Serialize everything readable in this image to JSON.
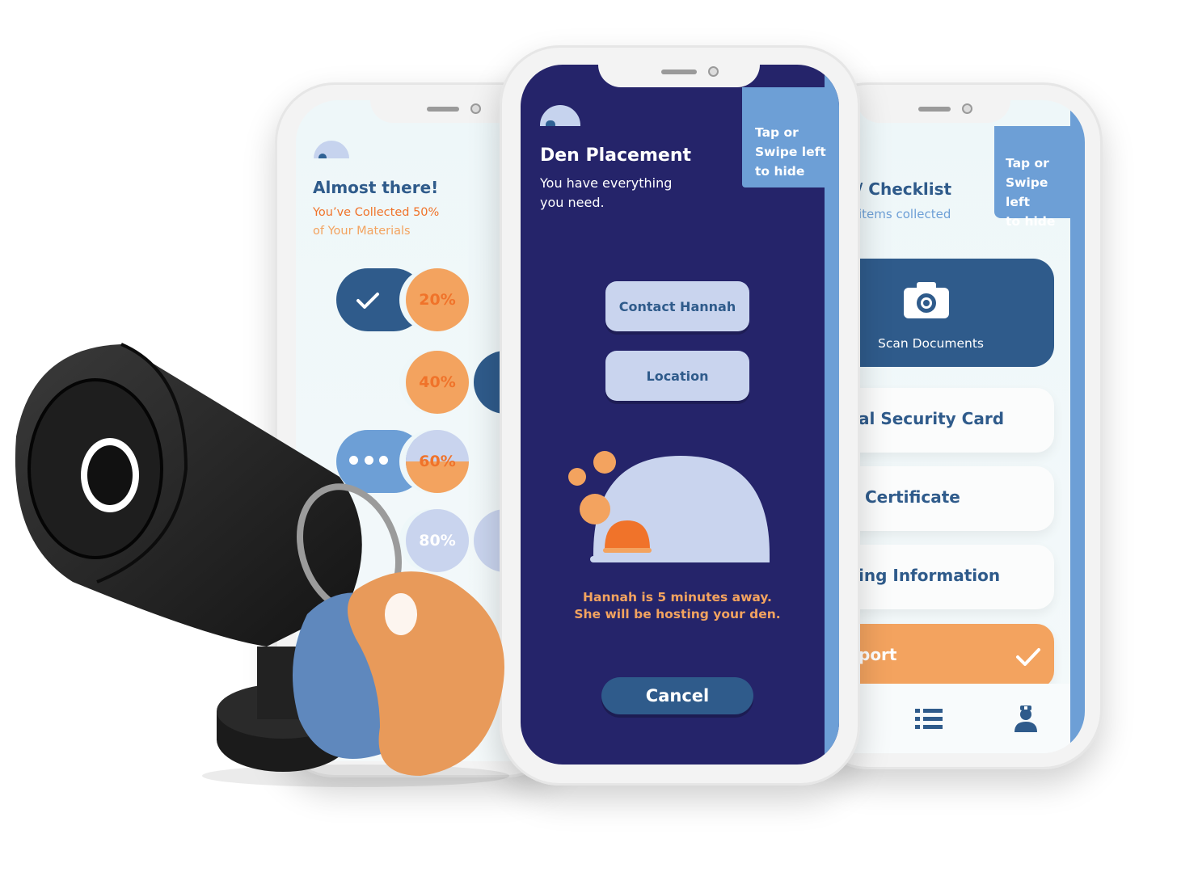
{
  "left_screen": {
    "title": "Almost there!",
    "subtitle_line1": "You’ve Collected 50%",
    "subtitle_line2": "of Your Materials",
    "steps": [
      {
        "label": "20%",
        "state": "complete"
      },
      {
        "label": "40%",
        "state": "complete"
      },
      {
        "label": "60%",
        "state": "in-progress"
      },
      {
        "label": "80%",
        "state": "pending"
      }
    ]
  },
  "center_screen": {
    "title": "Den Placement",
    "subtitle_line1": "You have everything",
    "subtitle_line2": "you need.",
    "hint_line1": "Tap or",
    "hint_line2": "Swipe left",
    "hint_line3": "to hide",
    "contact_button": "Contact Hannah",
    "location_button": "Location",
    "status_line1": "Hannah is 5 minutes away.",
    "status_line2": "She will be hosting your den.",
    "cancel_button": "Cancel"
  },
  "right_screen": {
    "title": "Checklist",
    "subtitle": "items collected",
    "hint_line1": "Tap or",
    "hint_line2": "Swipe left",
    "hint_line3": "to hide",
    "scan_label": "Scan Documents",
    "items": [
      {
        "label": "al Security Card"
      },
      {
        "label": "Certificate"
      },
      {
        "label": "ing Information"
      },
      {
        "label": "port"
      }
    ],
    "nav": [
      "list-icon",
      "doctor-icon"
    ]
  },
  "colors": {
    "navy": "#25246a",
    "blue": "#2f5b8b",
    "light_blue": "#6d9fd6",
    "orange": "#f3a35f",
    "deep_orange": "#f0732a",
    "pale": "#c9d4ee"
  }
}
